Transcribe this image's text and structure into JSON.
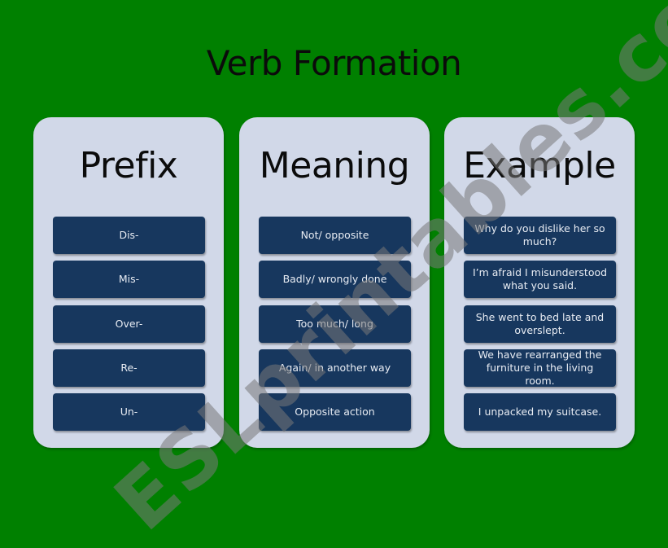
{
  "slide": {
    "title": "Verb Formation",
    "background_color": "#008000",
    "panel_color": "#d1d8e8",
    "cell_color": "#17375e"
  },
  "columns": [
    {
      "heading": "Prefix",
      "cells": [
        "Dis-",
        "Mis-",
        "Over-",
        "Re-",
        "Un-"
      ]
    },
    {
      "heading": "Meaning",
      "cells": [
        "Not/ opposite",
        "Badly/ wrongly done",
        "Too much/ long",
        "Again/ in another way",
        "Opposite action"
      ]
    },
    {
      "heading": "Example",
      "cells": [
        "Why do you dislike her so much?",
        "I’m afraid I misunderstood what you said.",
        "She went to bed late and overslept.",
        "We have rearranged the furniture in the living room.",
        "I unpacked  my suitcase."
      ]
    }
  ],
  "watermark": "ESLprintables.com"
}
